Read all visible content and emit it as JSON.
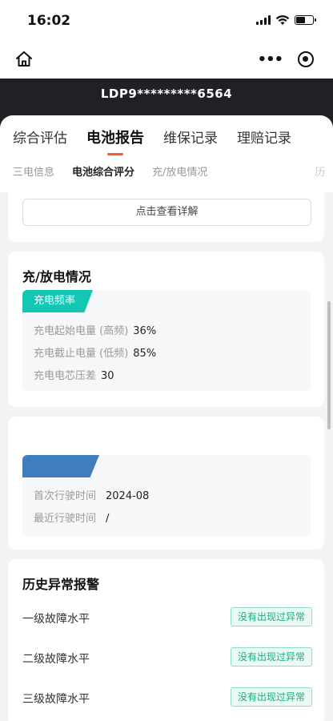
{
  "status_bar": {
    "time": "16:02"
  },
  "header": {
    "vin": "LDP9*********6564"
  },
  "main_tabs": [
    {
      "label": "综合评估"
    },
    {
      "label": "电池报告"
    },
    {
      "label": "维保记录"
    },
    {
      "label": "理赔记录"
    }
  ],
  "sub_tabs": [
    {
      "label": "三电信息"
    },
    {
      "label": "电池综合评分"
    },
    {
      "label": "充/放电情况"
    },
    {
      "label": "历"
    }
  ],
  "top_card": {
    "detail_button": "点击查看详解"
  },
  "charge_card": {
    "title": "充/放电情况",
    "tag": "充电频率",
    "rows": [
      {
        "label": "充电起始电量 (高频)",
        "value": "36%"
      },
      {
        "label": "充电截止电量 (低频)",
        "value": "85%"
      },
      {
        "label": "充电电芯压差",
        "value": "30"
      }
    ]
  },
  "drive_card": {
    "tag": "",
    "rows": [
      {
        "label": "首次行驶时间",
        "value": "2024-08"
      },
      {
        "label": "最近行驶时间",
        "value": "/"
      }
    ]
  },
  "alarm_card": {
    "title": "历史异常报警",
    "rows": [
      {
        "label": "一级故障水平",
        "status": "没有出现过异常"
      },
      {
        "label": "二级故障水平",
        "status": "没有出现过异常"
      },
      {
        "label": "三级故障水平",
        "status": "没有出现过异常"
      }
    ]
  },
  "colors": {
    "accent": "#ff5a1f",
    "teal": "#14c7b4",
    "blue": "#3f7dbd",
    "header_bg": "#1f2126",
    "badge_green": "#1faa7c"
  }
}
